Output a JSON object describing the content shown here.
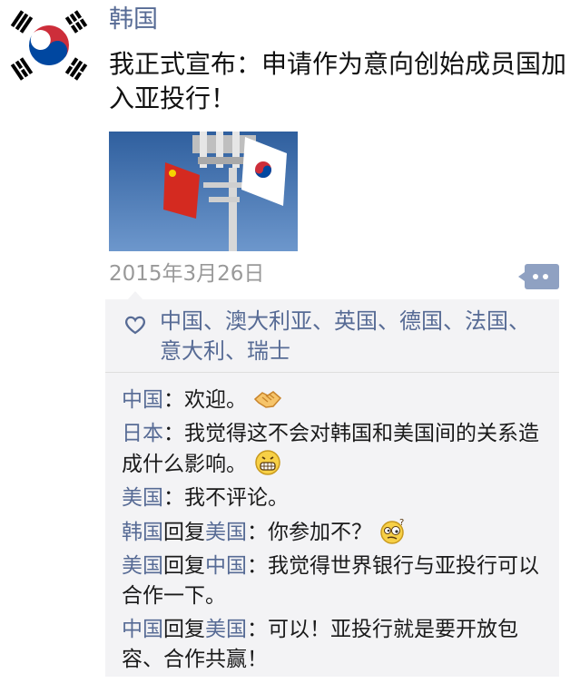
{
  "post": {
    "author": "韩国",
    "text": "我正式宣布：申请作为意向创始成员国加入亚投行！",
    "date": "2015年3月26日"
  },
  "likes": {
    "names": "中国、澳大利亚、英国、德国、法国、意大利、瑞士"
  },
  "comments": [
    {
      "author": "中国",
      "separator": "：",
      "text": "欢迎。",
      "emoji": "handshake-icon"
    },
    {
      "author": "日本",
      "separator": "：",
      "text": "我觉得这不会对韩国和美国间的关系造成什么影响。",
      "emoji": "grin-icon"
    },
    {
      "author": "美国",
      "separator": "：",
      "text": "我不评论。"
    },
    {
      "author": "韩国",
      "reply_word": "回复",
      "reply_to": "美国",
      "separator": "：",
      "text": "你参加不？",
      "emoji": "confused-icon"
    },
    {
      "author": "美国",
      "reply_word": "回复",
      "reply_to": "中国",
      "separator": "：",
      "text": "我觉得世界银行与亚投行可以合作一下。"
    },
    {
      "author": "中国",
      "reply_word": "回复",
      "reply_to": "美国",
      "separator": "：",
      "text": "可以！亚投行就是要开放包容、合作共赢！"
    }
  ],
  "colors": {
    "link_blue": "#576b95",
    "panel_bg": "#f3f3f5",
    "timestamp_gray": "#999999"
  }
}
